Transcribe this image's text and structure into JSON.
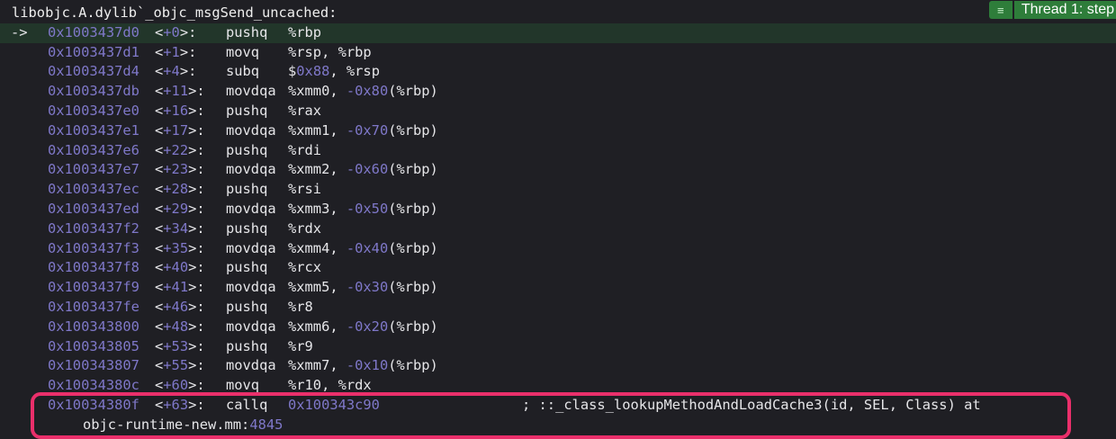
{
  "header": {
    "symbol": "libobjc.A.dylib`_objc_msgSend_uncached:"
  },
  "thread_badge": {
    "icon": "list-icon",
    "label": "Thread 1: step"
  },
  "pc_arrow": "->",
  "rows": [
    {
      "addr": "0x1003437d0",
      "off": "+0",
      "mn": "pushq",
      "ops": [
        [
          "%rbp",
          0
        ]
      ]
    },
    {
      "addr": "0x1003437d1",
      "off": "+1",
      "mn": "movq",
      "ops": [
        [
          "%rsp, %rbp",
          0
        ]
      ]
    },
    {
      "addr": "0x1003437d4",
      "off": "+4",
      "mn": "subq",
      "ops": [
        [
          "$",
          0
        ],
        [
          "0x88",
          1
        ],
        [
          ", %rsp",
          0
        ]
      ]
    },
    {
      "addr": "0x1003437db",
      "off": "+11",
      "mn": "movdqa",
      "ops": [
        [
          "%xmm0, ",
          0
        ],
        [
          "-0x80",
          1
        ],
        [
          "(%rbp)",
          0
        ]
      ]
    },
    {
      "addr": "0x1003437e0",
      "off": "+16",
      "mn": "pushq",
      "ops": [
        [
          "%rax",
          0
        ]
      ]
    },
    {
      "addr": "0x1003437e1",
      "off": "+17",
      "mn": "movdqa",
      "ops": [
        [
          "%xmm1, ",
          0
        ],
        [
          "-0x70",
          1
        ],
        [
          "(%rbp)",
          0
        ]
      ]
    },
    {
      "addr": "0x1003437e6",
      "off": "+22",
      "mn": "pushq",
      "ops": [
        [
          "%rdi",
          0
        ]
      ]
    },
    {
      "addr": "0x1003437e7",
      "off": "+23",
      "mn": "movdqa",
      "ops": [
        [
          "%xmm2, ",
          0
        ],
        [
          "-0x60",
          1
        ],
        [
          "(%rbp)",
          0
        ]
      ]
    },
    {
      "addr": "0x1003437ec",
      "off": "+28",
      "mn": "pushq",
      "ops": [
        [
          "%rsi",
          0
        ]
      ]
    },
    {
      "addr": "0x1003437ed",
      "off": "+29",
      "mn": "movdqa",
      "ops": [
        [
          "%xmm3, ",
          0
        ],
        [
          "-0x50",
          1
        ],
        [
          "(%rbp)",
          0
        ]
      ]
    },
    {
      "addr": "0x1003437f2",
      "off": "+34",
      "mn": "pushq",
      "ops": [
        [
          "%rdx",
          0
        ]
      ]
    },
    {
      "addr": "0x1003437f3",
      "off": "+35",
      "mn": "movdqa",
      "ops": [
        [
          "%xmm4, ",
          0
        ],
        [
          "-0x40",
          1
        ],
        [
          "(%rbp)",
          0
        ]
      ]
    },
    {
      "addr": "0x1003437f8",
      "off": "+40",
      "mn": "pushq",
      "ops": [
        [
          "%rcx",
          0
        ]
      ]
    },
    {
      "addr": "0x1003437f9",
      "off": "+41",
      "mn": "movdqa",
      "ops": [
        [
          "%xmm5, ",
          0
        ],
        [
          "-0x30",
          1
        ],
        [
          "(%rbp)",
          0
        ]
      ]
    },
    {
      "addr": "0x1003437fe",
      "off": "+46",
      "mn": "pushq",
      "ops": [
        [
          "%r8",
          0
        ]
      ]
    },
    {
      "addr": "0x100343800",
      "off": "+48",
      "mn": "movdqa",
      "ops": [
        [
          "%xmm6, ",
          0
        ],
        [
          "-0x20",
          1
        ],
        [
          "(%rbp)",
          0
        ]
      ]
    },
    {
      "addr": "0x100343805",
      "off": "+53",
      "mn": "pushq",
      "ops": [
        [
          "%r9",
          0
        ]
      ]
    },
    {
      "addr": "0x100343807",
      "off": "+55",
      "mn": "movdqa",
      "ops": [
        [
          "%xmm7, ",
          0
        ],
        [
          "-0x10",
          1
        ],
        [
          "(%rbp)",
          0
        ]
      ]
    },
    {
      "addr": "0x10034380c",
      "off": "+60",
      "mn": "movq",
      "ops": [
        [
          "%r10, %rdx",
          0
        ]
      ]
    },
    {
      "addr": "0x10034380f",
      "off": "+63",
      "mn": "callq",
      "ops": [
        [
          "0x100343c90",
          1
        ]
      ],
      "comment": "; ::_class_lookupMethodAndLoadCache3(id, SEL, Class) at",
      "cont": [
        [
          "objc-runtime-new.mm:",
          0
        ],
        [
          "4845",
          1
        ]
      ]
    }
  ]
}
